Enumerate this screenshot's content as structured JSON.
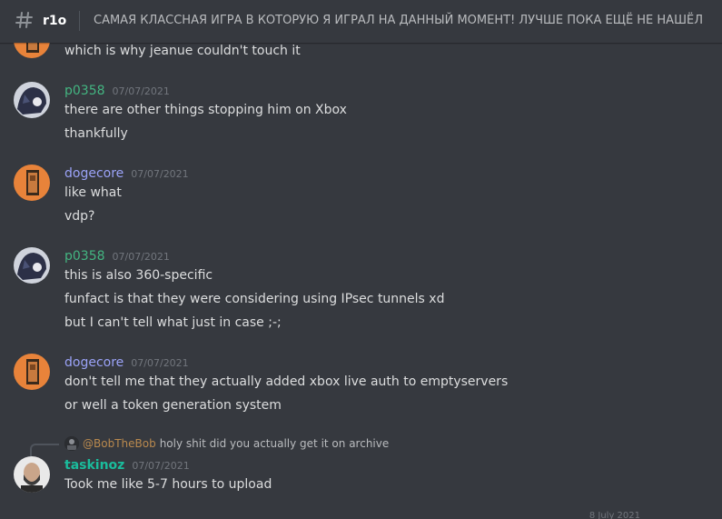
{
  "header": {
    "channel_name": "r1o",
    "topic": "САМАЯ КЛАССНАЯ ИГРА В КОТОРУЮ Я ИГРАЛ НА ДАННЫЙ МОМЕНТ! ЛУЧШЕ ПОКА ЕЩЁ НЕ НАШЁЛ"
  },
  "messages": [
    {
      "lines": [
        "which is why jeanue couldn't touch it"
      ]
    },
    {
      "username": "p0358",
      "timestamp": "07/07/2021",
      "lines": [
        "there are other things stopping him on Xbox",
        "thankfully"
      ]
    },
    {
      "username": "dogecore",
      "timestamp": "07/07/2021",
      "lines": [
        "like what",
        "vdp?"
      ]
    },
    {
      "username": "p0358",
      "timestamp": "07/07/2021",
      "lines": [
        "this is also 360-specific",
        "funfact is that they were considering using IPsec tunnels xd",
        "but I can't tell what just in case ;-;"
      ]
    },
    {
      "username": "dogecore",
      "timestamp": "07/07/2021",
      "lines": [
        "don't tell me that they actually added xbox live auth to emptyservers",
        "or well a token generation system"
      ]
    },
    {
      "reply": {
        "name": "@BobTheBob",
        "text": "holy shit did you actually get it on archive"
      },
      "username": "taskinoz",
      "timestamp": "07/07/2021",
      "lines": [
        "Took me like 5-7 hours to upload"
      ]
    }
  ],
  "date_divider": "8 July 2021",
  "colors": {
    "background": "#36393f",
    "username_green": "#43b581",
    "username_purple": "#9aa2f7",
    "username_teal": "#1abc9c"
  }
}
